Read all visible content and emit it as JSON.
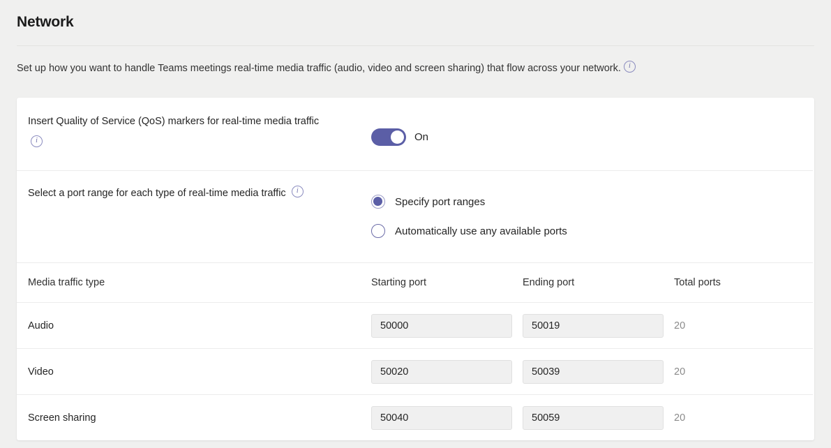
{
  "header": {
    "title": "Network",
    "description": "Set up how you want to handle Teams meetings real-time media traffic (audio, video and screen sharing) that flow across your network.",
    "info_icon": "info-icon"
  },
  "qos": {
    "label": "Insert Quality of Service (QoS) markers for real-time media traffic",
    "info_icon": "info-icon",
    "toggle_state": "on",
    "toggle_label": "On"
  },
  "port_range": {
    "label": "Select a port range for each type of real-time media traffic",
    "info_icon": "info-icon",
    "selected": "Specify port ranges",
    "options": [
      {
        "label": "Specify port ranges",
        "selected": true
      },
      {
        "label": "Automatically use any available ports",
        "selected": false
      }
    ]
  },
  "table": {
    "columns": [
      "Media traffic type",
      "Starting port",
      "Ending port",
      "Total ports"
    ],
    "rows": [
      {
        "type": "Audio",
        "starting_port": "50000",
        "ending_port": "50019",
        "total_ports": "20"
      },
      {
        "type": "Video",
        "starting_port": "50020",
        "ending_port": "50039",
        "total_ports": "20"
      },
      {
        "type": "Screen sharing",
        "starting_port": "50040",
        "ending_port": "50059",
        "total_ports": "20"
      }
    ]
  },
  "colors": {
    "accent": "#5b5ea6",
    "page_background": "#f0f0ef",
    "card_background": "#ffffff",
    "muted_text": "#8a8a8a",
    "input_background": "#f0f0f0"
  }
}
